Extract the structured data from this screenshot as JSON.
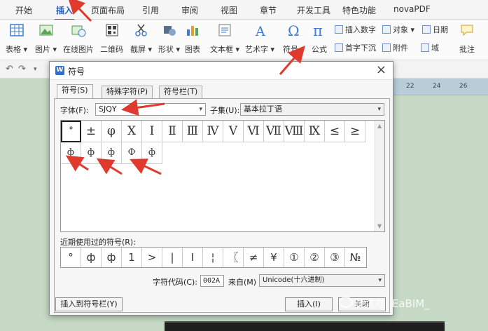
{
  "ribbon_tabs": [
    "开始",
    "插入",
    "页面布局",
    "引用",
    "审阅",
    "视图",
    "章节",
    "开发工具",
    "特色功能",
    "novaPDF"
  ],
  "active_tab": "插入",
  "ribbon": {
    "table": "表格 ▾",
    "picture": "图片 ▾",
    "online_picture": "在线图片",
    "qrcode": "二维码",
    "screenshot": "截屏 ▾",
    "shape": "形状 ▾",
    "chart": "图表",
    "textbox": "文本框 ▾",
    "wordart": "艺术字 ▾",
    "symbol": "符号 ▾",
    "formula": "公式",
    "insert_number": "插入数字",
    "object": "对象 ▾",
    "date": "日期",
    "dropcap": "首字下沉",
    "attachment": "附件",
    "field": "域",
    "comment": "批注"
  },
  "ruler_marks": [
    "22",
    "24",
    "26"
  ],
  "dialog": {
    "title": "符号",
    "tabs": [
      "符号(S)",
      "特殊字符(P)",
      "符号栏(T)"
    ],
    "font_label": "字体(F):",
    "font_value": "SJQY",
    "subset_label": "子集(U):",
    "subset_value": "基本拉丁语",
    "grid_row1": [
      "°",
      "±",
      "φ",
      "X",
      "I",
      "Ⅱ",
      "Ⅲ",
      "Ⅳ",
      "Ⅴ",
      "Ⅵ",
      "Ⅶ",
      "Ⅷ",
      "Ⅸ",
      "≤",
      "≥"
    ],
    "grid_row2": [
      "ф",
      "ф",
      "ф",
      "Ф",
      "ф"
    ],
    "recent_label": "近期使用过的符号(R):",
    "recent": [
      "°",
      "ф",
      "ф",
      "1",
      ">",
      "|",
      "I",
      "¦",
      "〖",
      "≠",
      "¥",
      "①",
      "②",
      "③",
      "№"
    ],
    "code_label": "字符代码(C):",
    "code_value": "002A",
    "from_label": "来自(M)",
    "from_value": "Unicode(十六进制)",
    "insert_to_bar": "插入到符号栏(Y)",
    "insert": "插入(I)",
    "close": "关闭"
  },
  "watermark": "微信号: EaBIM_",
  "colors": {
    "accent": "#2a62b9",
    "arrow": "#e03a2f",
    "doc_bg": "#c5d9c5"
  }
}
